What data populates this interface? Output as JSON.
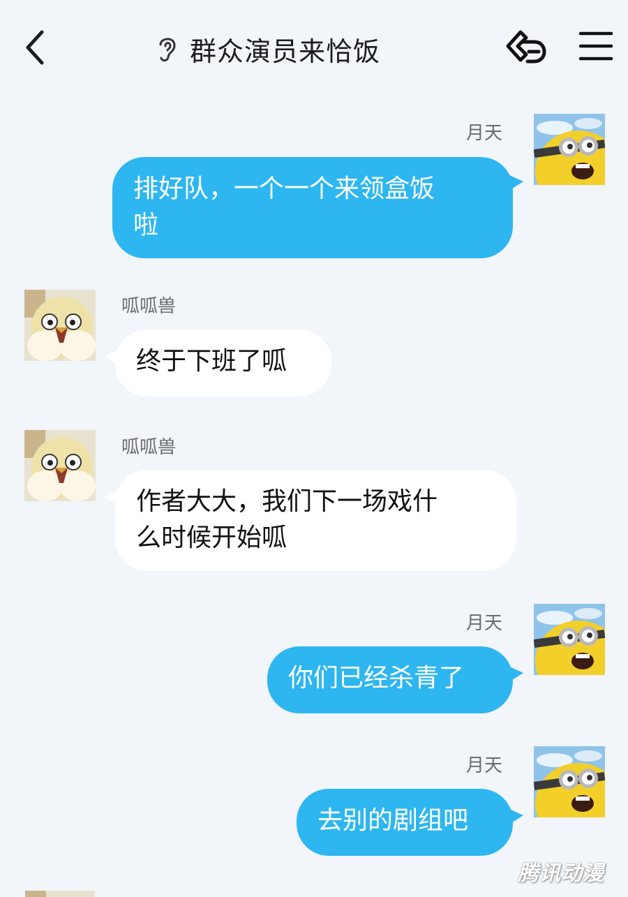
{
  "header": {
    "title": "群众演员来恰饭",
    "back_icon": "chevron-left-icon",
    "title_icon": "ear-icon",
    "share_icon": "share-link-icon",
    "menu_icon": "hamburger-menu-icon"
  },
  "colors": {
    "background": "#f2f5fa",
    "my_bubble": "#2eb6f0",
    "their_bubble": "#ffffff"
  },
  "messages": [
    {
      "sender": "月天",
      "side": "right",
      "text": "排好队，一个一个来领盒饭\n啦"
    },
    {
      "sender": "呱呱兽",
      "side": "left",
      "text": "终于下班了呱"
    },
    {
      "sender": "呱呱兽",
      "side": "left",
      "text": "作者大大，我们下一场戏什\n么时候开始呱"
    },
    {
      "sender": "月天",
      "side": "right",
      "text": "你们已经杀青了"
    },
    {
      "sender": "月天",
      "side": "right",
      "text": "去别的剧组吧"
    }
  ],
  "watermark": "腾讯动漫"
}
